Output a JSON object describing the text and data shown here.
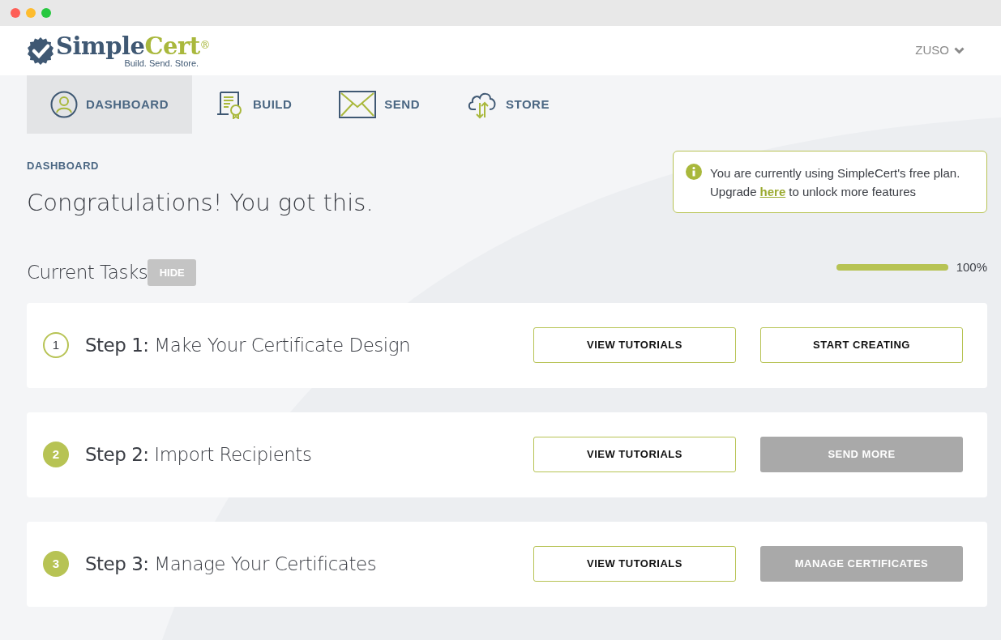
{
  "logo": {
    "wordmark_first": "Simple",
    "wordmark_second": "Cert",
    "registered": "®",
    "tagline": "Build. Send. Store."
  },
  "user_menu": {
    "label": "ZUSO"
  },
  "tabs": [
    {
      "label": "DASHBOARD",
      "kind": "person",
      "selected": true
    },
    {
      "label": "BUILD",
      "kind": "scroll",
      "selected": false
    },
    {
      "label": "SEND",
      "kind": "envelope",
      "selected": false
    },
    {
      "label": "STORE",
      "kind": "cloud",
      "selected": false
    }
  ],
  "page": {
    "breadcrumb": "DASHBOARD",
    "heading": "Congratulations! You got this."
  },
  "notice": {
    "line_1": "You are currently using SimpleCert's free plan.",
    "before_link": "Upgrade",
    "link": "here",
    "after_link": "to unlock more features"
  },
  "tasks": {
    "title": "Current Tasks",
    "hide_button": "HIDE",
    "progress": {
      "level": 1,
      "reading": "100%"
    },
    "steps": [
      {
        "number": "1",
        "title": "**Step 1:** Make Your Certificate Design",
        "done": false,
        "buttons": [
          {
            "label": "VIEW TUTORIALS",
            "disabled": false
          },
          {
            "label": "START CREATING",
            "disabled": false
          }
        ]
      },
      {
        "number": "2",
        "title": "**Step 2:** Import Recipients",
        "done": true,
        "buttons": [
          {
            "label": "VIEW TUTORIALS",
            "disabled": false
          },
          {
            "label": "SEND MORE",
            "disabled": true
          }
        ]
      },
      {
        "number": "3",
        "title": "**Step 3:** Manage Your Certificates",
        "done": true,
        "buttons": [
          {
            "label": "VIEW TUTORIALS",
            "disabled": false
          },
          {
            "label": "MANAGE CERTIFICATES",
            "disabled": true
          }
        ]
      }
    ]
  }
}
